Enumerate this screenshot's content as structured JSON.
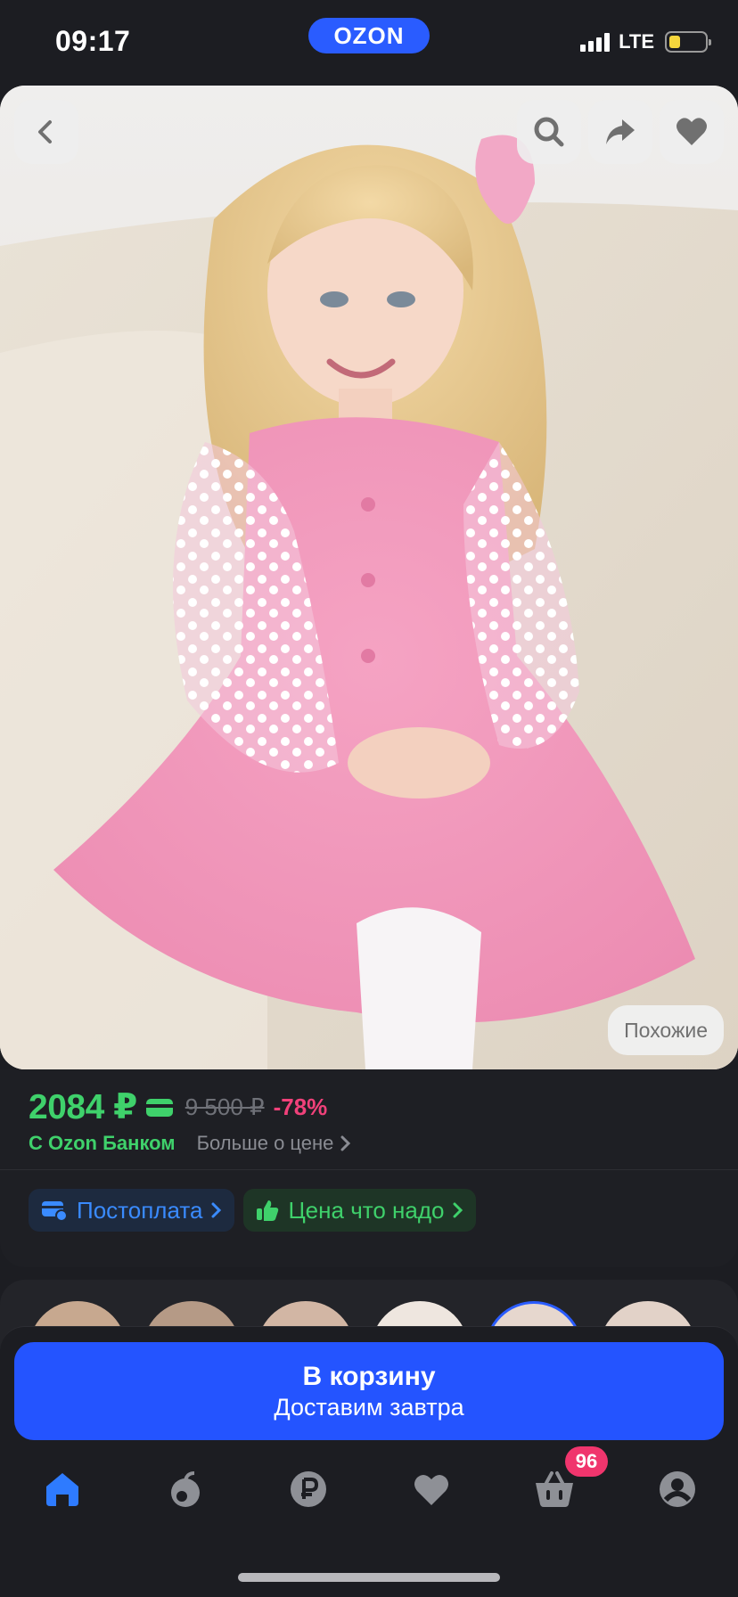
{
  "status_bar": {
    "time": "09:17",
    "brand": "OZON",
    "network": "LTE"
  },
  "image_controls": {
    "similar_label": "Похожие"
  },
  "price": {
    "current": "2084 ₽",
    "old": "9 500 ₽",
    "discount": "-78%",
    "bank_label": "С Ozon Банком",
    "more_label": "Больше о цене"
  },
  "chips": [
    {
      "label": "Постоплата"
    },
    {
      "label": "Цена что надо"
    }
  ],
  "cart": {
    "title": "В корзину",
    "subtitle": "Доставим завтра"
  },
  "nav": {
    "cart_badge": "96"
  },
  "colors": {
    "accent": "#2454ff",
    "price_green": "#3fd16b",
    "discount_pink": "#f0417a",
    "background": "#1c1d22"
  }
}
